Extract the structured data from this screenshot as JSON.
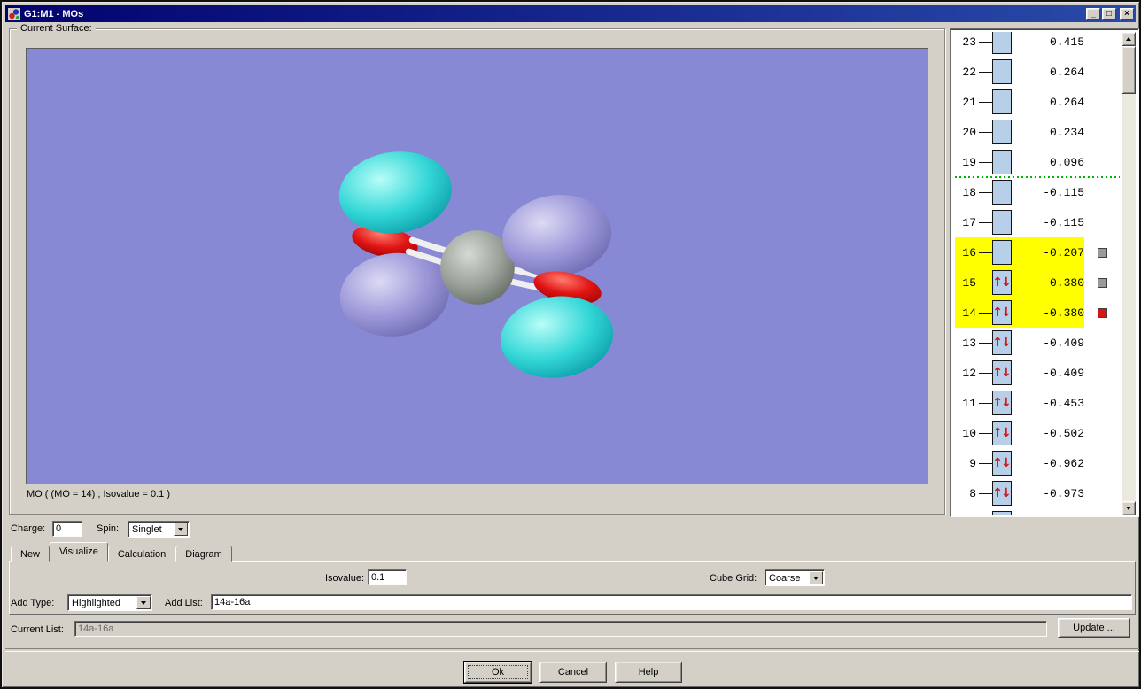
{
  "window": {
    "title": "G1:M1 - MOs",
    "buttons": {
      "minimize": "_",
      "maximize": "□",
      "close": "×"
    }
  },
  "surface_panel": {
    "group_label": "Current Surface:",
    "caption": "MO ( (MO = 14) ; Isovalue = 0.1 )"
  },
  "viewport": {
    "background_color": "#8789d4",
    "molecule": {
      "description": "CO2-type molecule with pi molecular orbital lobes",
      "colors": {
        "lobe_cyan": "#34d7d7",
        "lobe_purple": "#9b97d8",
        "atom_red": "#e11414",
        "atom_gray": "#9aa29a",
        "bond_white": "#efefef"
      }
    }
  },
  "mo_list": {
    "highlight_color": "#ffff00",
    "separator_color": "#00b400",
    "items": [
      {
        "num": "23",
        "energy": "0.415",
        "occupied": false,
        "highlight": false,
        "checkbox": null
      },
      {
        "num": "22",
        "energy": "0.264",
        "occupied": false,
        "highlight": false,
        "checkbox": null
      },
      {
        "num": "21",
        "energy": "0.264",
        "occupied": false,
        "highlight": false,
        "checkbox": null
      },
      {
        "num": "20",
        "energy": "0.234",
        "occupied": false,
        "highlight": false,
        "checkbox": null
      },
      {
        "num": "19",
        "energy": "0.096",
        "occupied": false,
        "highlight": false,
        "checkbox": null,
        "separator_after": true
      },
      {
        "num": "18",
        "energy": "-0.115",
        "occupied": false,
        "highlight": false,
        "checkbox": null
      },
      {
        "num": "17",
        "energy": "-0.115",
        "occupied": false,
        "highlight": false,
        "checkbox": null
      },
      {
        "num": "16",
        "energy": "-0.207",
        "occupied": false,
        "highlight": true,
        "checkbox": "gray"
      },
      {
        "num": "15",
        "energy": "-0.380",
        "occupied": true,
        "highlight": true,
        "checkbox": "gray"
      },
      {
        "num": "14",
        "energy": "-0.380",
        "occupied": true,
        "highlight": true,
        "checkbox": "red"
      },
      {
        "num": "13",
        "energy": "-0.409",
        "occupied": true,
        "highlight": false,
        "checkbox": null
      },
      {
        "num": "12",
        "energy": "-0.409",
        "occupied": true,
        "highlight": false,
        "checkbox": null
      },
      {
        "num": "11",
        "energy": "-0.453",
        "occupied": true,
        "highlight": false,
        "checkbox": null
      },
      {
        "num": "10",
        "energy": "-0.502",
        "occupied": true,
        "highlight": false,
        "checkbox": null
      },
      {
        "num": "9",
        "energy": "-0.962",
        "occupied": true,
        "highlight": false,
        "checkbox": null
      },
      {
        "num": "8",
        "energy": "-0.973",
        "occupied": true,
        "highlight": false,
        "checkbox": null
      },
      {
        "num": "",
        "energy": "",
        "occupied": true,
        "highlight": false,
        "checkbox": null,
        "partial": true
      }
    ]
  },
  "tabs": {
    "items": [
      "New",
      "Visualize",
      "Calculation",
      "Diagram"
    ],
    "active": "Visualize"
  },
  "controls": {
    "charge_label": "Charge:",
    "charge_value": "0",
    "spin_label": "Spin:",
    "spin_value": "Singlet",
    "isovalue_label": "Isovalue:",
    "isovalue_value": "0.1",
    "cube_grid_label": "Cube Grid:",
    "cube_grid_value": "Coarse",
    "add_type_label": "Add Type:",
    "add_type_value": "Highlighted",
    "add_list_label": "Add List:",
    "add_list_value": "14a-16a",
    "current_list_label": "Current List:",
    "current_list_value": "14a-16a",
    "update_button": "Update ...",
    "ok_button": "Ok",
    "cancel_button": "Cancel",
    "help_button": "Help"
  }
}
